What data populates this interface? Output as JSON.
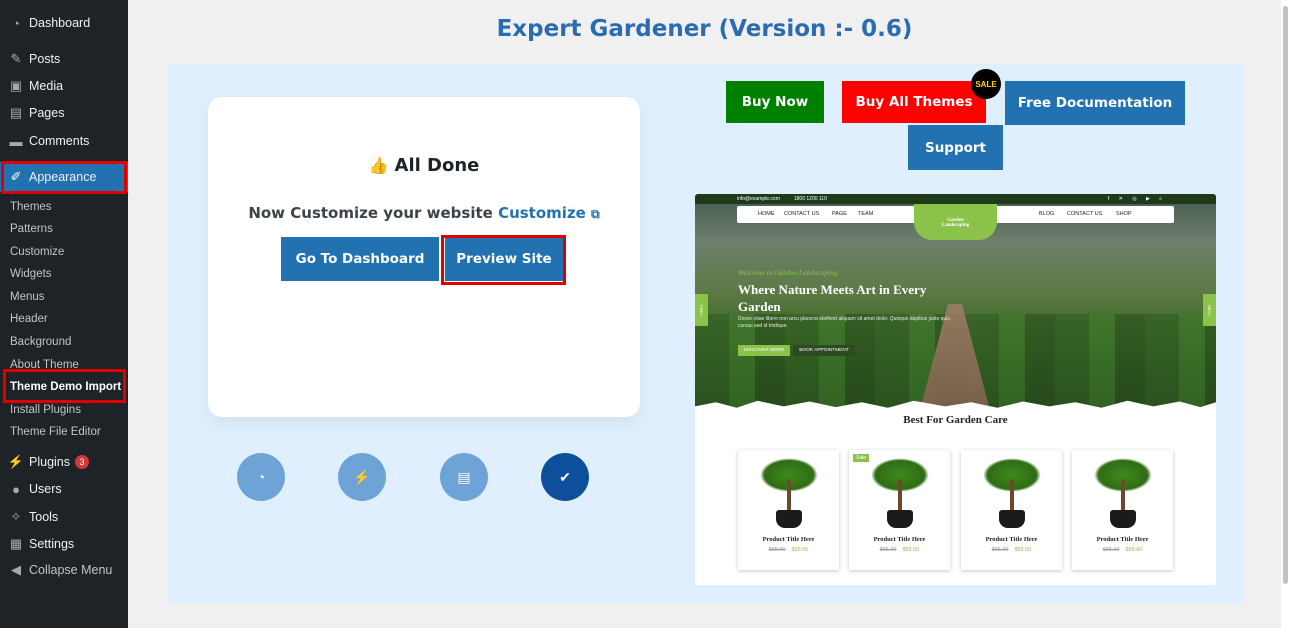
{
  "sidebar": {
    "dashboard": "Dashboard",
    "posts": "Posts",
    "media": "Media",
    "pages": "Pages",
    "comments": "Comments",
    "appearance": "Appearance",
    "submenu": [
      "Themes",
      "Patterns",
      "Customize",
      "Widgets",
      "Menus",
      "Header",
      "Background",
      "About Theme",
      "Theme Demo Import",
      "Install Plugins",
      "Theme File Editor"
    ],
    "plugins": "Plugins",
    "plugins_badge": "3",
    "users": "Users",
    "tools": "Tools",
    "settings": "Settings",
    "collapse": "Collapse Menu"
  },
  "page": {
    "title": "Expert Gardener (Version :- 0.6)"
  },
  "card": {
    "heading": "All Done",
    "customize_prefix": "Now Customize your website",
    "customize_link": "Customize",
    "dashboard_button": "Go To Dashboard",
    "preview_button": "Preview Site"
  },
  "top_buttons": {
    "buy_now": "Buy Now",
    "buy_all": "Buy All Themes",
    "sale": "SALE",
    "docs": "Free Documentation",
    "support": "Support"
  },
  "colors": {
    "buy_now": "#008000",
    "buy_all": "#ff0000",
    "blue": "#2271b1",
    "highlight": "#e00000"
  },
  "preview": {
    "email": "info@example.com",
    "phone": "1800 1200 110",
    "nav_left": [
      "HOME",
      "CONTACT US",
      "PAGE",
      "TEAM"
    ],
    "nav_right": [
      "BLOG",
      "CONTACT US",
      "SHOP"
    ],
    "logo_line1": "Garden",
    "logo_line2": "Landscaping",
    "welcome": "Welcome to Garden Landscaping",
    "hero_title": "Where Nature Meets Art in Every Garden",
    "hero_desc": "Donec vitae libero non arcu placerat eleifend aliquam sit amet dolor. Quisque dapibus justo quis, cursus sed id tristique.",
    "btn_discover": "DISCOVER MORE",
    "btn_book": "BOOK APPOINTMENT",
    "prev": "PREV",
    "next": "NEXT",
    "section_title": "Best For Garden Care",
    "products": [
      {
        "name": "Product Title Here",
        "old_price": "$55.00",
        "price": "$55.00",
        "sale": ""
      },
      {
        "name": "Product Title Here",
        "old_price": "$55.00",
        "price": "$55.00",
        "sale": "Sale"
      },
      {
        "name": "Product Title Here",
        "old_price": "$55.00",
        "price": "$55.00",
        "sale": ""
      },
      {
        "name": "Product Title Here",
        "old_price": "$55.00",
        "price": "$55.00",
        "sale": ""
      }
    ]
  },
  "steps": [
    {
      "icon": "dashboard-gauge-icon",
      "state": "inactive"
    },
    {
      "icon": "plugin-icon",
      "state": "inactive"
    },
    {
      "icon": "layout-icon",
      "state": "inactive"
    },
    {
      "icon": "check-icon",
      "state": "done"
    }
  ]
}
